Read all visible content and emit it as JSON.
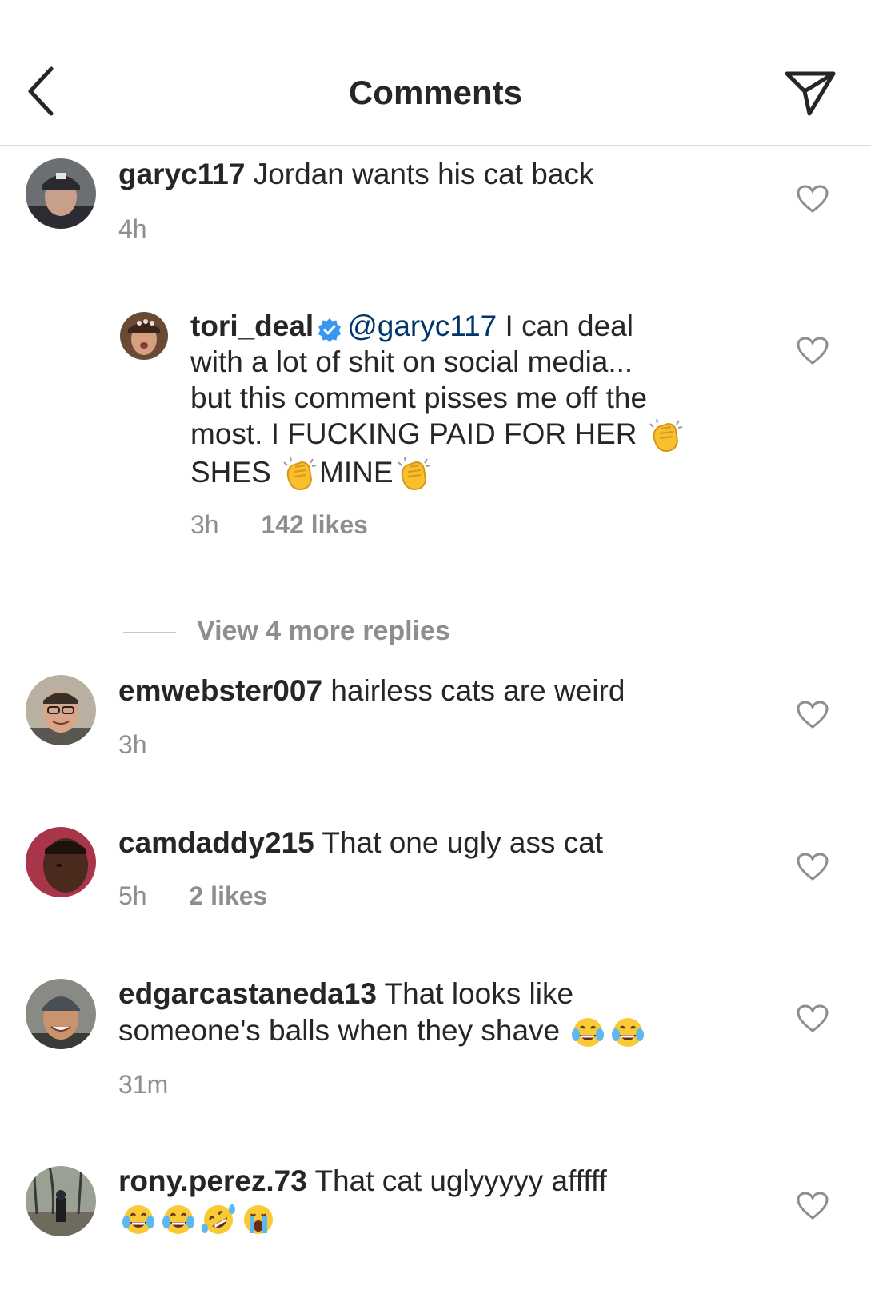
{
  "header": {
    "title": "Comments"
  },
  "comments": [
    {
      "username": "garyc117",
      "text": "Jordan wants his cat back",
      "time": "4h"
    },
    {
      "username": "tori_deal",
      "mention": "@garyc117",
      "text1": "I can deal",
      "text2": "with a lot of shit  on social media...",
      "text3": "but this comment pisses me off the",
      "text4": "most. I FUCKING PAID FOR HER",
      "text5a": "SHES",
      "text5b": "MINE",
      "time": "3h",
      "likes": "142 likes",
      "emojis": [
        "clapping-hands",
        "clapping-hands",
        "clapping-hands"
      ]
    },
    {
      "username": "emwebster007",
      "text": "hairless cats are weird",
      "time": "3h"
    },
    {
      "username": "camdaddy215",
      "text": "That one ugly ass cat",
      "time": "5h",
      "likes": "2 likes"
    },
    {
      "username": "edgarcastaneda13",
      "text1": "That looks like",
      "text2": "someone's balls when they shave",
      "time": "31m",
      "emojis": [
        "face-with-tears-of-joy",
        "face-with-tears-of-joy"
      ]
    },
    {
      "username": "rony.perez.73",
      "text": "That cat uglyyyyy afffff",
      "emojis": [
        "face-with-tears-of-joy",
        "face-with-tears-of-joy",
        "rolling-on-the-floor-laughing",
        "loudly-crying-face"
      ]
    }
  ],
  "replies": {
    "label": "View 4 more replies"
  },
  "colors": {
    "text": "#262626",
    "meta": "#8e8e8e",
    "mention": "#00376b",
    "verified": "#3897f0",
    "divider": "#dbdbdb"
  }
}
